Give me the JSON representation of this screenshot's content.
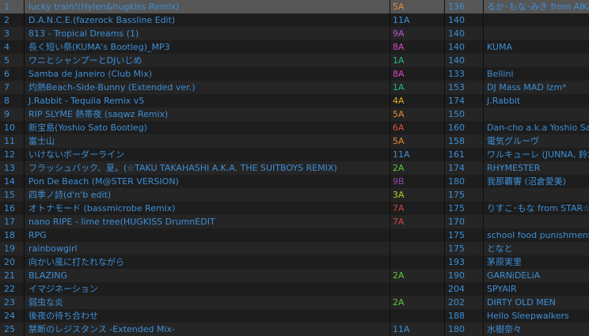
{
  "tracks": [
    {
      "num": "1",
      "title": "lucky train!(Hylen&hugkiss Remix)",
      "key": "5A",
      "key_color": "#e58a2e",
      "bpm": "136",
      "artist": "るか･もな･みき from AIKATSU☆STARS!"
    },
    {
      "num": "2",
      "title": "D.A.N.C.E.(fazerock Bassline Edit)",
      "key": "11A",
      "key_color": "#3d8fd6",
      "bpm": "140",
      "artist": ""
    },
    {
      "num": "3",
      "title": "813 - Tropical Dreams (1)",
      "key": "9A",
      "key_color": "#b45ad0",
      "bpm": "140",
      "artist": ""
    },
    {
      "num": "4",
      "title": "長く短い祭(KUMA's Bootleg)_MP3",
      "key": "8A",
      "key_color": "#d94bc4",
      "bpm": "140",
      "artist": "KUMA"
    },
    {
      "num": "5",
      "title": "ワニとシャンプーとDJいじめ",
      "key": "1A",
      "key_color": "#1fb88a",
      "bpm": "140",
      "artist": ""
    },
    {
      "num": "6",
      "title": "Samba de Janeiro (Club Mix)",
      "key": "8A",
      "key_color": "#d94bc4",
      "bpm": "133",
      "artist": "Bellini"
    },
    {
      "num": "7",
      "title": "灼熱Beach-Side-Bunny (Extended ver.)",
      "key": "1A",
      "key_color": "#1fb88a",
      "bpm": "153",
      "artist": "DJ Mass MAD Izm*"
    },
    {
      "num": "8",
      "title": "J.Rabbit - Tequila Remix v5",
      "key": "4A",
      "key_color": "#e0b020",
      "bpm": "174",
      "artist": "J.Rabbit"
    },
    {
      "num": "9",
      "title": "RIP SLYME 熱帯夜 (saqwz Remix)",
      "key": "5A",
      "key_color": "#e58a2e",
      "bpm": "150",
      "artist": ""
    },
    {
      "num": "10",
      "title": "新宝島(Yoshio Sato Bootleg)",
      "key": "6A",
      "key_color": "#e0504a",
      "bpm": "160",
      "artist": "Dan-cho a.k.a Yoshio Sato"
    },
    {
      "num": "11",
      "title": "富士山",
      "key": "5A",
      "key_color": "#e58a2e",
      "bpm": "158",
      "artist": "電気グルーヴ"
    },
    {
      "num": "12",
      "title": "いけないボーダーライン",
      "key": "11A",
      "key_color": "#3d8fd6",
      "bpm": "161",
      "artist": "ワルキューレ (JUNNA, 鈴木みのり)"
    },
    {
      "num": "13",
      "title": "フラッシュバック、夏。(☆TAKU TAKAHASHI A.K.A. THE SUITBOYS REMIX)",
      "key": "2A",
      "key_color": "#5bc83a",
      "bpm": "174",
      "artist": "RHYMESTER"
    },
    {
      "num": "14",
      "title": "Pon De Beach (M@STER VERSION)",
      "key": "9B",
      "key_color": "#8a4aa8",
      "bpm": "180",
      "artist": "我那覇響 (沼倉愛美)"
    },
    {
      "num": "15",
      "title": "四季ノ詩(d'n'b edit)",
      "key": "3A",
      "key_color": "#b8cc28",
      "bpm": "175",
      "artist": ""
    },
    {
      "num": "16",
      "title": "オトナモード (bassmicrobe Remix)",
      "key": "7A",
      "key_color": "#d04545",
      "bpm": "175",
      "artist": "りすこ･もな from STAR☆ANIS"
    },
    {
      "num": "17",
      "title": "nano RIPE - lime tree(HUGKISS DrumnEDIT",
      "key": "7A",
      "key_color": "#d04545",
      "bpm": "170",
      "artist": ""
    },
    {
      "num": "18",
      "title": "RPG",
      "key": "",
      "key_color": "#3d8fd6",
      "bpm": "175",
      "artist": "school food punishment"
    },
    {
      "num": "19",
      "title": "rainbowgirl",
      "key": "",
      "key_color": "#3d8fd6",
      "bpm": "175",
      "artist": "となと"
    },
    {
      "num": "20",
      "title": "向かい風に打たれながら",
      "key": "",
      "key_color": "#3d8fd6",
      "bpm": "193",
      "artist": "茅原実里"
    },
    {
      "num": "21",
      "title": "BLAZING",
      "key": "2A",
      "key_color": "#5bc83a",
      "bpm": "190",
      "artist": "GARNiDELiA"
    },
    {
      "num": "22",
      "title": "イマジネーション",
      "key": "",
      "key_color": "#3d8fd6",
      "bpm": "204",
      "artist": "SPYAIR"
    },
    {
      "num": "23",
      "title": "弱虫な炎",
      "key": "2A",
      "key_color": "#5bc83a",
      "bpm": "202",
      "artist": "DIRTY OLD MEN"
    },
    {
      "num": "24",
      "title": "後夜の待ち合わせ",
      "key": "",
      "key_color": "#3d8fd6",
      "bpm": "188",
      "artist": "Hello Sleepwalkers"
    },
    {
      "num": "25",
      "title": "禁断のレジスタンス -Extended Mix-",
      "key": "11A",
      "key_color": "#3d8fd6",
      "bpm": "180",
      "artist": "水樹奈々"
    }
  ],
  "selected_index": 0
}
